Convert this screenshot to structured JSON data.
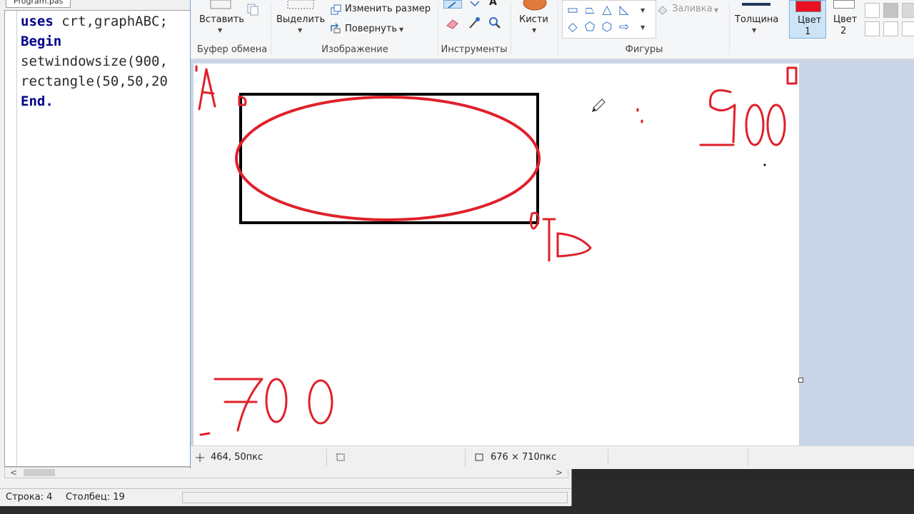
{
  "ide": {
    "tab_title": "Program.pas",
    "code": {
      "line1_kw": "uses",
      "line1_rest": " crt,graphABC;",
      "line2": "Begin",
      "line3": "setwindowsize(900,",
      "line4": "rectangle(50,50,20",
      "line5": "End."
    },
    "status": {
      "row_label": "Строка: 4",
      "col_label": "Столбец: 19"
    },
    "scroll_left": "<",
    "scroll_right": ">"
  },
  "ribbon": {
    "paste_label": "Вставить",
    "clipboard_group": "Буфер обмена",
    "select_label": "Выделить",
    "resize_label": "Изменить размер",
    "rotate_label": "Повернуть",
    "image_group": "Изображение",
    "tools_group": "Инструменты",
    "text_tool": "A",
    "brushes_label": "Кисти",
    "fill_label": "Заливка",
    "shapes_group": "Фигуры",
    "thickness_label": "Толщина",
    "color1_label_a": "Цвет",
    "color1_label_b": "1",
    "color2_label_a": "Цвет",
    "color2_label_b": "2"
  },
  "colors": {
    "color1": "#e81123",
    "color2": "#ffffff",
    "shape_accent": "#2b6fbf",
    "drawing_red": "#e0202a",
    "canvas_bg": "#c9d5e6"
  },
  "icons": [
    "paste-icon",
    "copy-icon",
    "select-icon",
    "resize-icon",
    "rotate-icon",
    "pencil-icon",
    "fill-bucket-icon",
    "text-icon",
    "eraser-icon",
    "color-picker-icon",
    "magnifier-icon",
    "brush-icon",
    "cursor-position-icon",
    "selection-size-icon",
    "canvas-size-icon"
  ],
  "paint_status": {
    "cursor_pos": "464, 50пкс",
    "canvas_size": "676 × 710пкс"
  }
}
